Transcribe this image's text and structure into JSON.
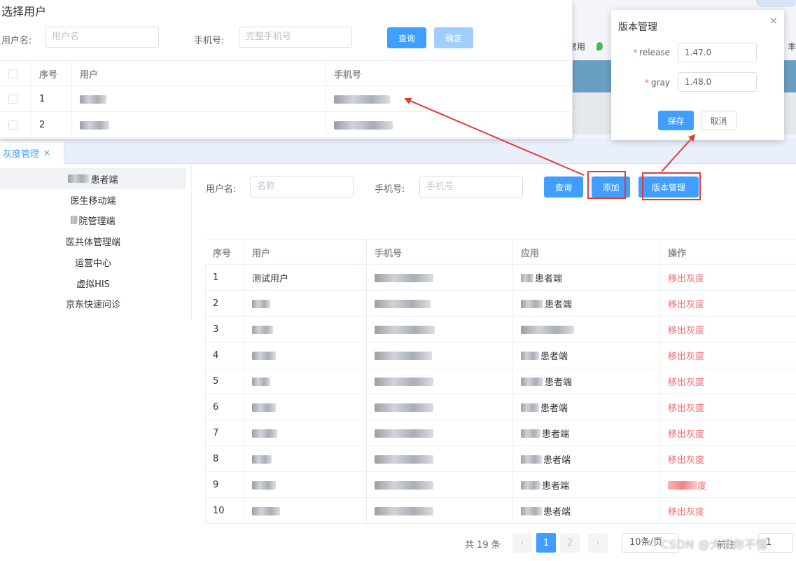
{
  "browser": {
    "bookmark_text": "常用",
    "edge_text": "丰"
  },
  "tab": {
    "label": "灰度管理",
    "close": "×"
  },
  "sidebar": {
    "items": [
      {
        "prefix_blurred": true,
        "label": "患者端"
      },
      {
        "prefix_blurred": false,
        "label": "医生移动端"
      },
      {
        "prefix_blurred": true,
        "label": "院管理端"
      },
      {
        "prefix_blurred": false,
        "label": "医共体管理端"
      },
      {
        "prefix_blurred": false,
        "label": "运营中心"
      },
      {
        "prefix_blurred": false,
        "label": "虚拟HIS"
      },
      {
        "prefix_blurred": false,
        "label": "京东快速问诊"
      }
    ]
  },
  "filter": {
    "username_label": "用户名:",
    "username_placeholder": "名称",
    "phone_label": "手机号:",
    "phone_placeholder": "手机号",
    "query_button": "查询",
    "add_button": "添加",
    "version_button": "版本管理"
  },
  "table": {
    "headers": [
      "序号",
      "用户",
      "手机号",
      "应用",
      "操作"
    ],
    "rows": [
      {
        "idx": "1",
        "user": "测试用户",
        "app": "患者端",
        "op": "移出灰度"
      },
      {
        "idx": "2",
        "user": "",
        "app": "患者端",
        "op": "移出灰度"
      },
      {
        "idx": "3",
        "user": "",
        "app": "",
        "op": "移出灰度"
      },
      {
        "idx": "4",
        "user": "",
        "app": "患者端",
        "op": "移出灰度"
      },
      {
        "idx": "5",
        "user": "",
        "app": "患者端",
        "op": "移出灰度"
      },
      {
        "idx": "6",
        "user": "",
        "app": "患者端",
        "op": "移出灰度"
      },
      {
        "idx": "7",
        "user": "",
        "app": "患者端",
        "op": "移出灰度"
      },
      {
        "idx": "8",
        "user": "",
        "app": "患者端",
        "op": "移出灰度"
      },
      {
        "idx": "9",
        "user": "",
        "app": "患者端",
        "op": "度"
      },
      {
        "idx": "10",
        "user": "",
        "app": "患者端",
        "op": "移出灰度"
      }
    ]
  },
  "pager": {
    "total": "共 19 条",
    "prev": "‹",
    "page1": "1",
    "page2": "2",
    "next": "›",
    "page_size": "10条/页",
    "goto": "前往",
    "page_input": "1"
  },
  "select_user_dialog": {
    "title": "选择用户",
    "username_label": "用户名:",
    "username_placeholder": "用户名",
    "phone_label": "手机号:",
    "phone_placeholder": "完整手机号",
    "query_button": "查询",
    "confirm_button": "确定",
    "headers": [
      "序号",
      "用户",
      "手机号"
    ],
    "rows": [
      {
        "idx": "1"
      },
      {
        "idx": "2"
      }
    ]
  },
  "version_dialog": {
    "title": "版本管理",
    "close": "×",
    "release_label": "release",
    "release_value": "1.47.0",
    "gray_label": "gray",
    "gray_value": "1.48.0",
    "save_button": "保存",
    "cancel_button": "取消"
  },
  "watermark": "CSDN @大手你不懂",
  "colors": {
    "primary": "#409eff",
    "danger": "#f56c6c",
    "annotation": "#e53935"
  }
}
